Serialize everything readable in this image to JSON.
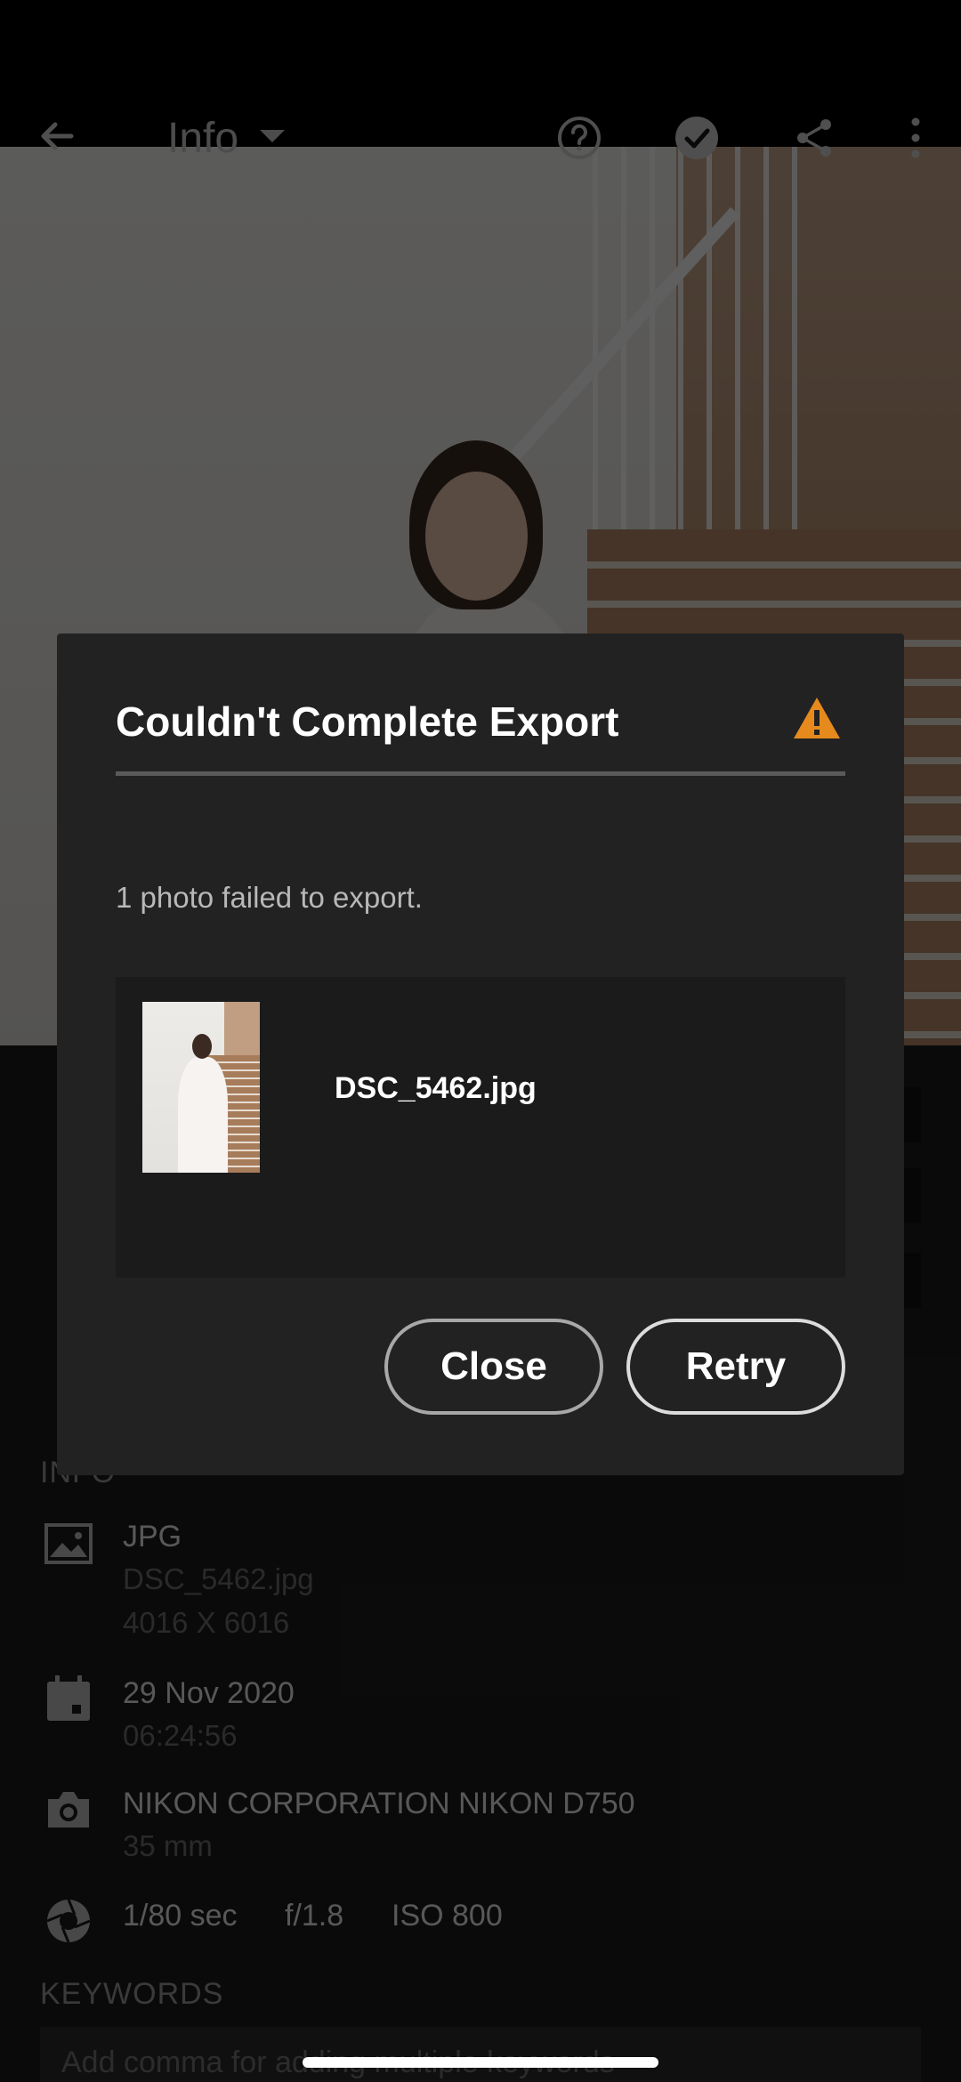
{
  "top_bar": {
    "title": "Info"
  },
  "panel": {
    "section_info_label": "INFO",
    "file": {
      "type": "JPG",
      "name": "DSC_5462.jpg",
      "dimensions": "4016 X 6016"
    },
    "date": {
      "date": "29 Nov 2020",
      "time": "06:24:56"
    },
    "camera": {
      "model": "NIKON CORPORATION NIKON D750",
      "focal_length": "35 mm"
    },
    "exposure": {
      "shutter": "1/80 sec",
      "aperture": "f/1.8",
      "iso": "ISO 800"
    },
    "keywords_label": "KEYWORDS",
    "keywords_placeholder": "Add comma for adding multiple keywords"
  },
  "dialog": {
    "title": "Couldn't Complete Export",
    "message": "1 photo failed to export.",
    "file_name": "DSC_5462.jpg",
    "close_label": "Close",
    "retry_label": "Retry",
    "warning_color": "#E68A1E"
  }
}
